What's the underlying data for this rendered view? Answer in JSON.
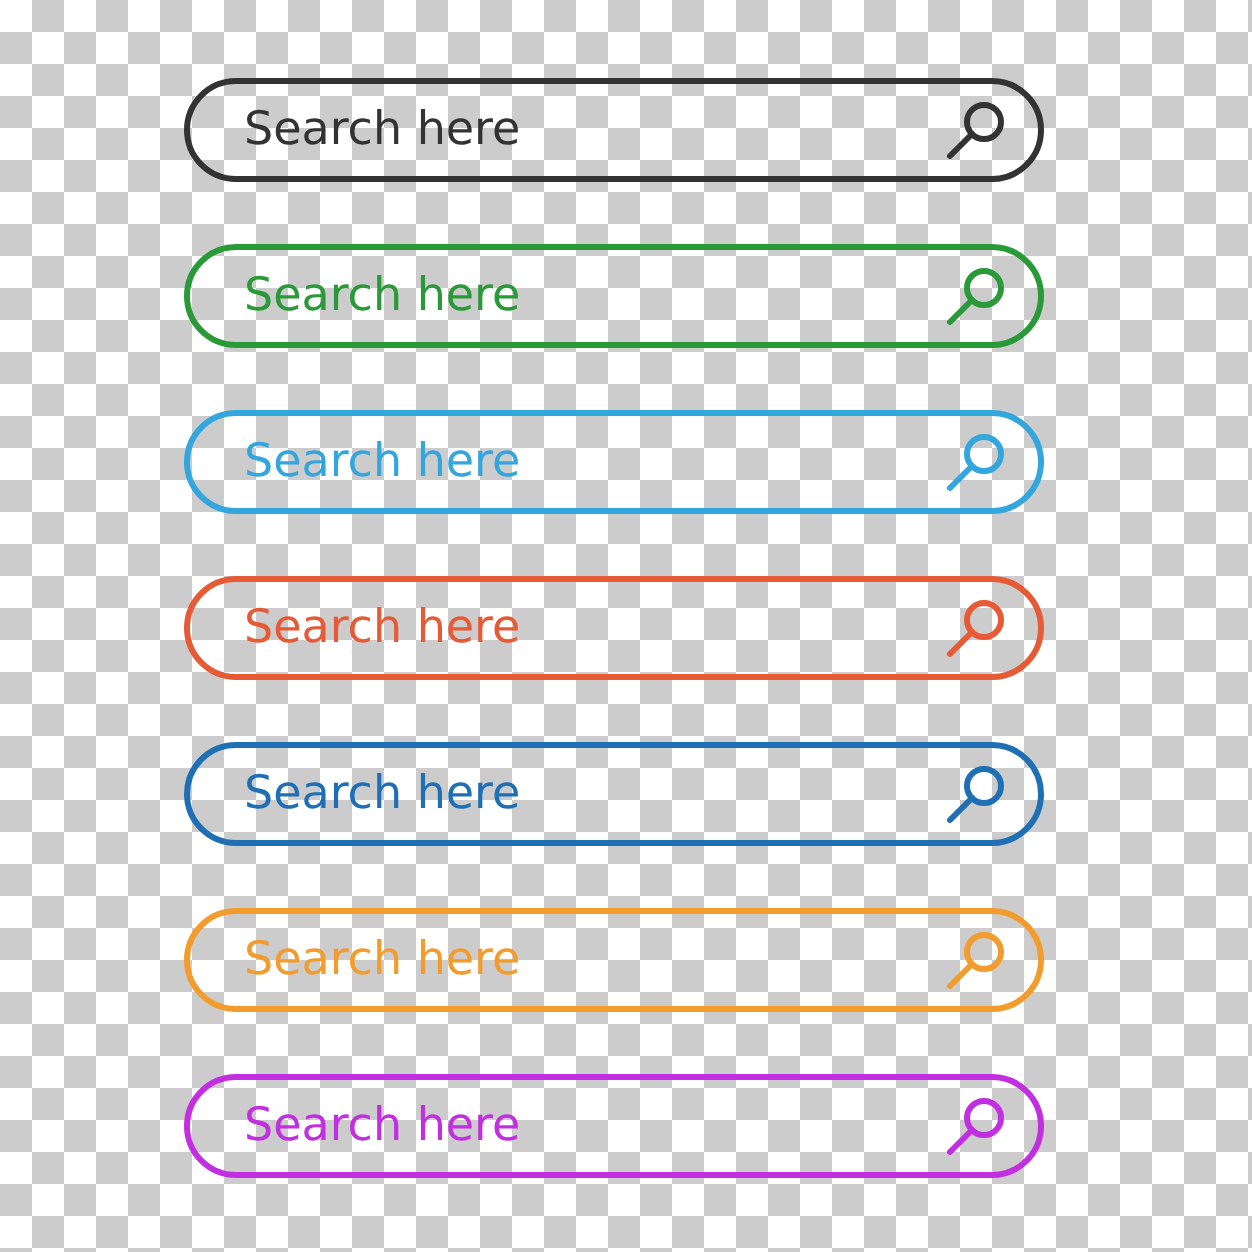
{
  "search_bars": [
    {
      "placeholder": "Search here",
      "color": "#333333"
    },
    {
      "placeholder": "Search here",
      "color": "#2a9a38"
    },
    {
      "placeholder": "Search here",
      "color": "#33a6dd"
    },
    {
      "placeholder": "Search here",
      "color": "#e65a36"
    },
    {
      "placeholder": "Search here",
      "color": "#1f6fb5"
    },
    {
      "placeholder": "Search here",
      "color": "#f39c2e"
    },
    {
      "placeholder": "Search here",
      "color": "#c22fe0"
    }
  ]
}
